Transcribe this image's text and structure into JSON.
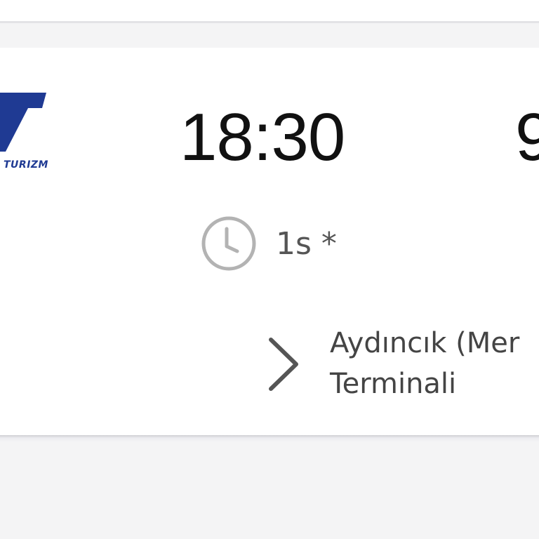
{
  "operator": {
    "logo_icon": "operator-logo-t",
    "name": "TURIZM",
    "brand_color": "#1f3a93"
  },
  "trip": {
    "departure_time": "18:30",
    "arrival_time_partial": "9",
    "duration": "1s *",
    "duration_icon": "clock-icon",
    "stop_icon": "chevron-right-icon",
    "stop_line_1": "Aydıncık (Mer",
    "stop_line_2": "Terminali"
  },
  "colors": {
    "text_primary": "#111111",
    "text_secondary": "#555555",
    "icon_gray": "#b3b3b3",
    "card_background": "#ffffff",
    "page_background": "#f4f4f5"
  }
}
